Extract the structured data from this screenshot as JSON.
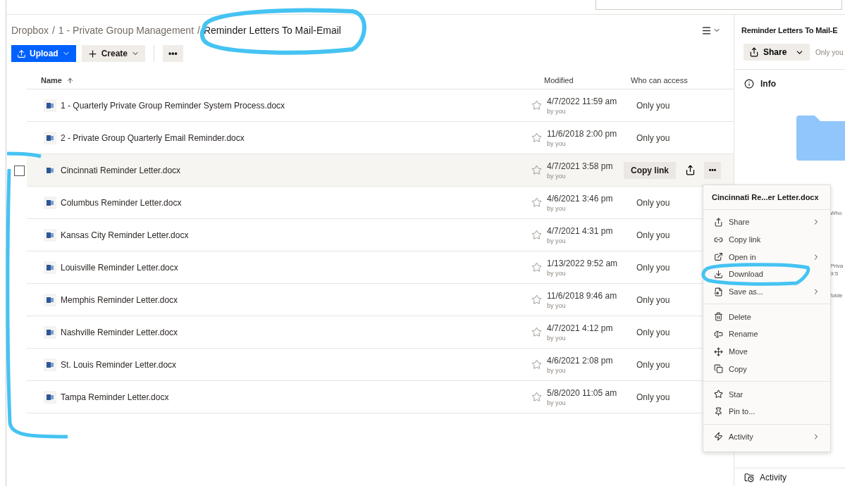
{
  "breadcrumb": {
    "separator": "/",
    "items": [
      "Dropbox",
      "1 - Private Group Management",
      "Reminder Letters To Mail-Email"
    ]
  },
  "toolbar": {
    "upload": "Upload",
    "create": "Create",
    "more": "•••"
  },
  "columns": {
    "name": "Name",
    "modified": "Modified",
    "access": "Who can access"
  },
  "rows": [
    {
      "name": "1 - Quarterly Private Group Reminder System Process.docx",
      "modified": "4/7/2022 11:59 am",
      "by": "by you",
      "access": "Only you",
      "hovered": false
    },
    {
      "name": "2 - Private Group Quarterly Email Reminder.docx",
      "modified": "11/6/2018 2:00 pm",
      "by": "by you",
      "access": "Only you",
      "hovered": false
    },
    {
      "name": "Cincinnati Reminder Letter.docx",
      "modified": "4/7/2021 3:58 pm",
      "by": "by you",
      "copy_link": "Copy link",
      "more": "•••",
      "hovered": true,
      "checked": false
    },
    {
      "name": "Columbus Reminder Letter.docx",
      "modified": "4/6/2021 3:46 pm",
      "by": "by you",
      "access": "Only you",
      "hovered": false
    },
    {
      "name": "Kansas City Reminder Letter.docx",
      "modified": "4/7/2021 4:31 pm",
      "by": "by you",
      "access": "Only you",
      "hovered": false
    },
    {
      "name": "Louisville Reminder Letter.docx",
      "modified": "1/13/2022 9:52 am",
      "by": "by you",
      "access": "Only you",
      "hovered": false
    },
    {
      "name": "Memphis Reminder Letter.docx",
      "modified": "11/6/2018 9:46 am",
      "by": "by you",
      "access": "Only you",
      "hovered": false
    },
    {
      "name": "Nashville Reminder Letter.docx",
      "modified": "4/7/2021 4:12 pm",
      "by": "by you",
      "access": "Only you",
      "hovered": false
    },
    {
      "name": "St. Louis Reminder Letter.docx",
      "modified": "4/6/2021 2:08 pm",
      "by": "by you",
      "access": "Only you",
      "hovered": false
    },
    {
      "name": "Tampa Reminder Letter.docx",
      "modified": "5/8/2020 11:05 am",
      "by": "by you",
      "access": "Only you",
      "hovered": false
    }
  ],
  "context_menu": {
    "title": "Cincinnati Re...er Letter.docx",
    "sections": [
      [
        {
          "kind": "share",
          "label": "Share",
          "submenu": true
        },
        {
          "kind": "link",
          "label": "Copy link",
          "submenu": false
        },
        {
          "kind": "open",
          "label": "Open in",
          "submenu": true
        },
        {
          "kind": "download",
          "label": "Download",
          "submenu": false
        },
        {
          "kind": "saveas",
          "label": "Save as...",
          "submenu": true
        }
      ],
      [
        {
          "kind": "delete",
          "label": "Delete",
          "submenu": false
        },
        {
          "kind": "rename",
          "label": "Rename",
          "submenu": false
        },
        {
          "kind": "move",
          "label": "Move",
          "submenu": false
        },
        {
          "kind": "copy",
          "label": "Copy",
          "submenu": false
        }
      ],
      [
        {
          "kind": "star",
          "label": "Star",
          "submenu": false
        },
        {
          "kind": "pin",
          "label": "Pin to...",
          "submenu": false
        }
      ],
      [
        {
          "kind": "activity",
          "label": "Activity",
          "submenu": true
        }
      ]
    ]
  },
  "side_panel": {
    "title": "Reminder Letters To Mail-E",
    "share": "Share",
    "access": "Only you",
    "info": "Info",
    "fragments": [
      "Who",
      "Priva",
      "9:5",
      "folde"
    ],
    "activity": "Activity"
  }
}
